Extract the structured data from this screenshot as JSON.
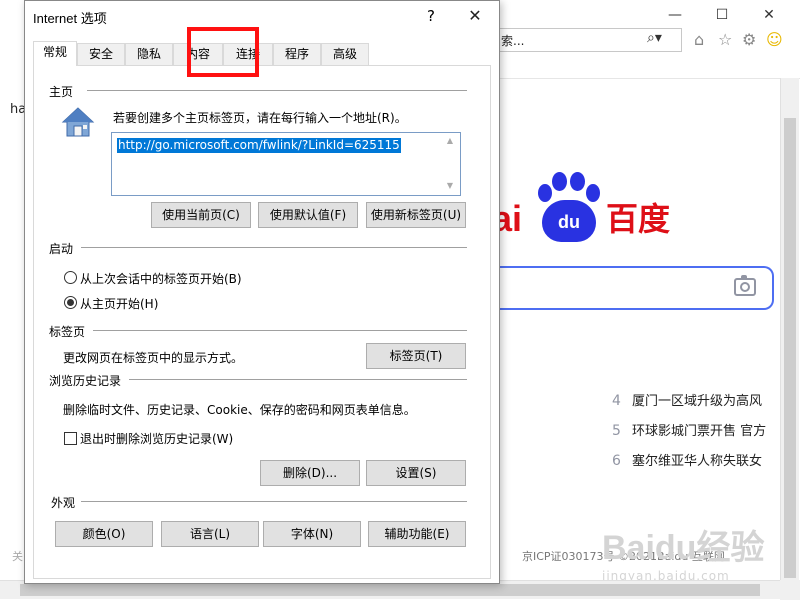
{
  "browser": {
    "window_controls": {
      "minimize": "—",
      "maximize": "☐",
      "close": "✕"
    },
    "address_text": "索...",
    "search_glyph": "⌕▾",
    "toolbar_icons": [
      "home-icon",
      "star-icon",
      "gear-icon",
      "smiley-icon"
    ],
    "left_text": "ha",
    "logo_prefix": "ai",
    "logo_paw_text": "du",
    "logo_cn": "百度",
    "hot_list": [
      {
        "num": "4",
        "text": "厦门一区域升级为高风"
      },
      {
        "num": "5",
        "text": "环球影城门票开售 官方"
      },
      {
        "num": "6",
        "text": "塞尔维亚华人称失联女"
      }
    ],
    "footer_left": "关",
    "footer_right": "京ICP证030173号  ©2021Baidu  互联网",
    "watermark_main": "Baidu经验",
    "watermark_sub": "jingyan.baidu.com"
  },
  "dialog": {
    "title": "Internet 选项",
    "help_label": "?",
    "close_label": "✕",
    "tabs": [
      "常规",
      "安全",
      "隐私",
      "内容",
      "连接",
      "程序",
      "高级"
    ],
    "home_page": {
      "title": "主页",
      "instruction": "若要创建多个主页标签页，请在每行输入一个地址(R)。",
      "url": "http://go.microsoft.com/fwlink/?LinkId=625115",
      "buttons": [
        "使用当前页(C)",
        "使用默认值(F)",
        "使用新标签页(U)"
      ]
    },
    "startup": {
      "title": "启动",
      "options": [
        "从上次会话中的标签页开始(B)",
        "从主页开始(H)"
      ],
      "selected_index": 1
    },
    "tabs_section": {
      "title": "标签页",
      "description": "更改网页在标签页中的显示方式。",
      "button": "标签页(T)"
    },
    "history": {
      "title": "浏览历史记录",
      "description": "删除临时文件、历史记录、Cookie、保存的密码和网页表单信息。",
      "checkbox_label": "退出时删除浏览历史记录(W)",
      "checkbox_checked": false,
      "delete_button": "删除(D)...",
      "settings_button": "设置(S)"
    },
    "appearance": {
      "title": "外观",
      "buttons": [
        "颜色(O)",
        "语言(L)",
        "字体(N)",
        "辅助功能(E)"
      ]
    }
  },
  "colors": {
    "highlight_box": "#ff1111",
    "selection": "#0078d7",
    "baidu_red": "#de0f17",
    "baidu_blue": "#2932e1",
    "search_border": "#4e6ef2"
  }
}
